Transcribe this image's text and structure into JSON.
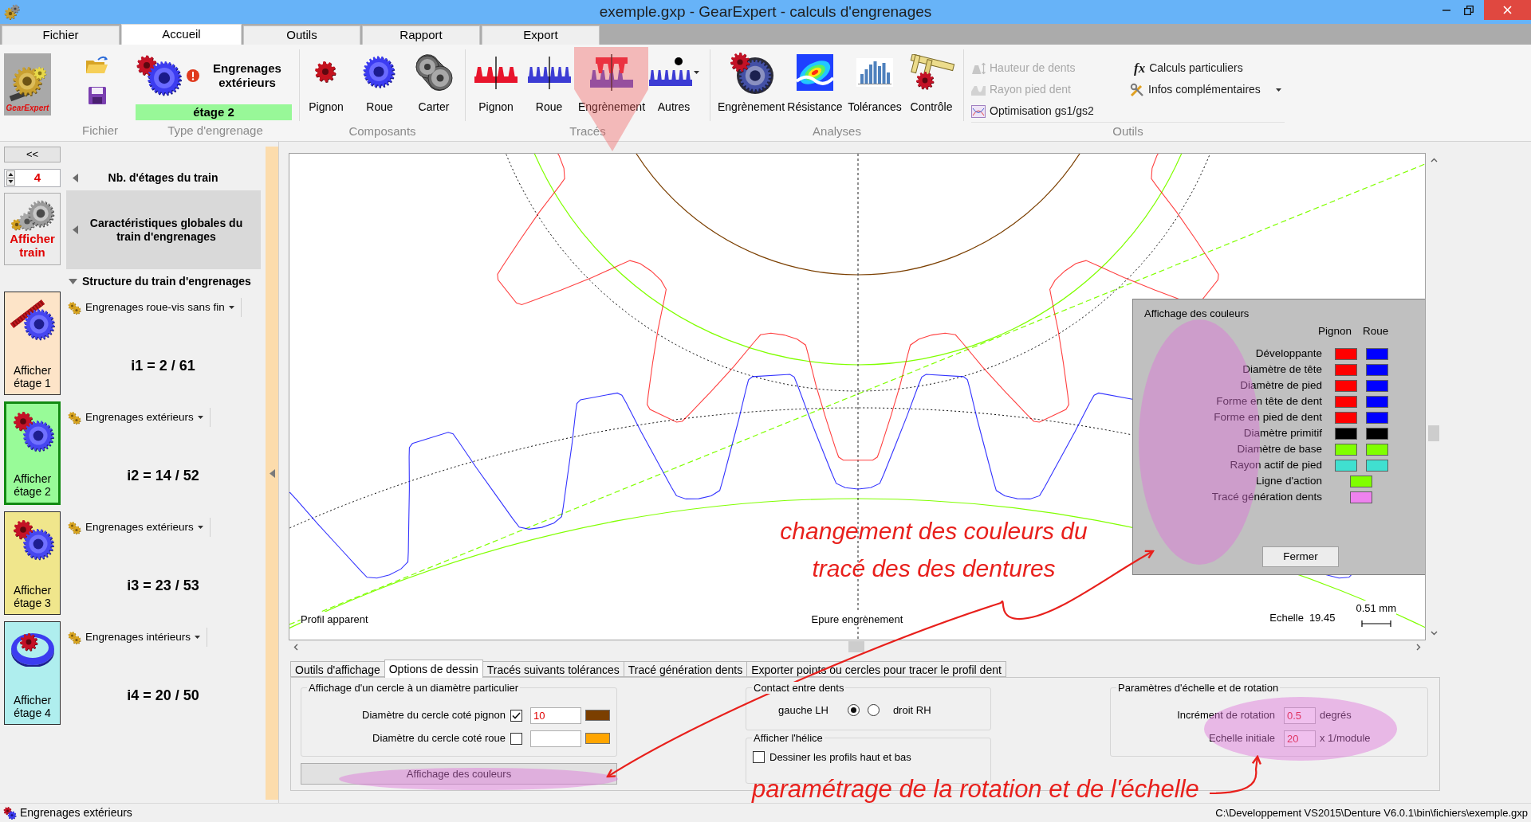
{
  "window": {
    "title": "exemple.gxp - GearExpert - calculs d'engrenages"
  },
  "menu_tabs": [
    {
      "label": "Fichier",
      "selected": false
    },
    {
      "label": "Accueil",
      "selected": true
    },
    {
      "label": "Outils",
      "selected": false
    },
    {
      "label": "Rapport",
      "selected": false
    },
    {
      "label": "Export",
      "selected": false
    }
  ],
  "ribbon": {
    "file_group": {
      "label": "Fichier",
      "logo_text": "GearExpert"
    },
    "type_group": {
      "label": "Type d'engrenage",
      "type": "Engrenages extérieurs",
      "warning": true,
      "stage": "étage 2"
    },
    "button_groups": [
      {
        "label": "Composants",
        "buttons": [
          {
            "label": "Pignon",
            "kind": "pinion",
            "dropdown": false
          },
          {
            "label": "Roue",
            "kind": "wheel",
            "dropdown": false
          },
          {
            "label": "Carter",
            "kind": "housing",
            "dropdown": false
          }
        ]
      },
      {
        "label": "Tracés",
        "buttons": [
          {
            "label": "Pignon",
            "kind": "flank",
            "dropdown": false
          },
          {
            "label": "Roue",
            "kind": "rim",
            "dropdown": false
          },
          {
            "label": "Engrènement",
            "kind": "mesh",
            "dropdown": false
          },
          {
            "label": "Autres",
            "kind": "other",
            "dropdown": true
          }
        ]
      },
      {
        "label": "Analyses",
        "buttons": [
          {
            "label": "Engrènement",
            "kind": "assembly",
            "dropdown": false
          },
          {
            "label": "Résistance",
            "kind": "stress",
            "dropdown": false
          },
          {
            "label": "Tolérances",
            "kind": "tolerance",
            "dropdown": false
          },
          {
            "label": "Contrôle",
            "kind": "gauge",
            "dropdown": false
          }
        ]
      }
    ],
    "tools_group": {
      "label": "Outils",
      "items": [
        {
          "label": "Hauteur de dents",
          "kind": "height",
          "disabled": true,
          "dropdown": false
        },
        {
          "label": "Rayon pied dent",
          "kind": "radius",
          "disabled": true,
          "dropdown": false
        },
        {
          "label": "Optimisation gs1/gs2",
          "kind": "optimization",
          "disabled": false,
          "dropdown": false
        },
        {
          "label": "Calculs particuliers",
          "kind": "formula",
          "symbol": "fx",
          "disabled": false,
          "dropdown": false
        },
        {
          "label": "Infos complémentaires",
          "kind": "info",
          "disabled": false,
          "dropdown": true
        }
      ]
    }
  },
  "train_panel": {
    "collapse_button": "<<",
    "stage_count": "4",
    "show_train_button": "Afficher train",
    "sections": [
      {
        "title": "Nb. d'étages du train",
        "expanded": false,
        "selected": false
      },
      {
        "title": "Caractéristiques globales du train d'engrenages",
        "expanded": false,
        "selected": true
      },
      {
        "title": "Structure du train d'engrenages",
        "expanded": true,
        "selected": false
      }
    ],
    "stages": [
      {
        "button": "Afficher étage 1",
        "kind": "worm",
        "color": "#fde4c8",
        "selected": false,
        "gear_type": "Engrenages roue-vis sans fin",
        "ratio": "i1 = 2 / 61"
      },
      {
        "button": "Afficher étage 2",
        "kind": "external",
        "color": "#98fb98",
        "selected": true,
        "gear_type": "Engrenages extérieurs",
        "ratio": "i2 = 14 / 52"
      },
      {
        "button": "Afficher étage 3",
        "kind": "external",
        "color": "#f0e68c",
        "selected": false,
        "gear_type": "Engrenages extérieurs",
        "ratio": "i3 = 23 / 53"
      },
      {
        "button": "Afficher étage 4",
        "kind": "internal",
        "color": "#afeeee",
        "selected": false,
        "gear_type": "Engrenages intérieurs",
        "ratio": "i4 = 20 / 50"
      }
    ]
  },
  "drawing": {
    "left_label": "Profil apparent",
    "center_label": "Epure engrènement",
    "scale_label": "Echelle",
    "scale_value": "19.45",
    "scale_bar_label": "0.51 mm"
  },
  "color_panel": {
    "title": "Affichage des couleurs",
    "columns": [
      "Pignon",
      "Roue"
    ],
    "rows": [
      {
        "label": "Développante",
        "swatches": [
          {
            "color": "#ff0000"
          },
          {
            "color": "#0000ff"
          }
        ]
      },
      {
        "label": "Diamètre de tête",
        "swatches": [
          {
            "color": "#ff0000"
          },
          {
            "color": "#0000ff"
          }
        ]
      },
      {
        "label": "Diamètre de pied",
        "swatches": [
          {
            "color": "#ff0000"
          },
          {
            "color": "#0000ff"
          }
        ]
      },
      {
        "label": "Forme en tête de dent",
        "swatches": [
          {
            "color": "#ff0000"
          },
          {
            "color": "#0000ff"
          }
        ]
      },
      {
        "label": "Forme en pied de dent",
        "swatches": [
          {
            "color": "#ff0000"
          },
          {
            "color": "#0000ff"
          }
        ]
      },
      {
        "label": "Diamètre primitif",
        "swatches": [
          {
            "color": "#000000"
          },
          {
            "color": "#000000"
          }
        ]
      },
      {
        "label": "Diamètre de base",
        "swatches": [
          {
            "color": "#80ff00"
          },
          {
            "color": "#80ff00"
          }
        ]
      },
      {
        "label": "Rayon actif de pied",
        "swatches": [
          {
            "color": "#40e0d0"
          },
          {
            "color": "#40e0d0"
          }
        ]
      },
      {
        "label": "Ligne d'action",
        "swatches": [
          {
            "color": "#80ff00"
          }
        ]
      },
      {
        "label": "Tracé génération dents",
        "swatches": [
          {
            "color": "#ee82ee"
          }
        ]
      }
    ],
    "close_button": "Fermer"
  },
  "options_tabs": [
    {
      "label": "Outils d'affichage",
      "selected": false
    },
    {
      "label": "Options de dessin",
      "selected": true
    },
    {
      "label": "Tracés suivants tolérances",
      "selected": false
    },
    {
      "label": "Tracé génération dents",
      "selected": false
    },
    {
      "label": "Exporter points ou cercles pour tracer le profil dent",
      "selected": false
    }
  ],
  "options_panel": {
    "circle_group": {
      "title": "Affichage d'un cercle à un diamètre particulier",
      "rows": [
        {
          "label": "Diamètre du cercle coté pignon",
          "checked": true,
          "value": "10",
          "color": "#7b3f00"
        },
        {
          "label": "Diamètre du cercle coté roue",
          "checked": false,
          "color": "#ffa500"
        }
      ]
    },
    "colors_button": "Affichage des couleurs",
    "contact_group": {
      "title": "Contact entre dents",
      "options": [
        {
          "label": "gauche LH",
          "selected": true
        },
        {
          "label": "droit RH",
          "selected": false
        }
      ]
    },
    "helix_group": {
      "title": "Afficher l'hélice",
      "checkbox": {
        "label": "Dessiner les profils haut et bas",
        "checked": false
      }
    },
    "scale_group": {
      "title": "Paramètres d'échelle et de rotation",
      "fields": [
        {
          "label": "Incrément de rotation",
          "value": "0.5",
          "unit": "degrés"
        },
        {
          "label": "Echelle initiale",
          "value": "20",
          "unit": "x 1/module"
        }
      ]
    }
  },
  "annotations": [
    {
      "text": "changement des couleurs du\ntracé des des dentures"
    },
    {
      "text": "paramétrage de la rotation et de l'échelle"
    }
  ],
  "status_bar": {
    "left": "Engrenages extérieurs",
    "right": "C:\\Developpement VS2015\\Denture V6.0.1\\bin\\fichiers\\exemple.gxp"
  }
}
